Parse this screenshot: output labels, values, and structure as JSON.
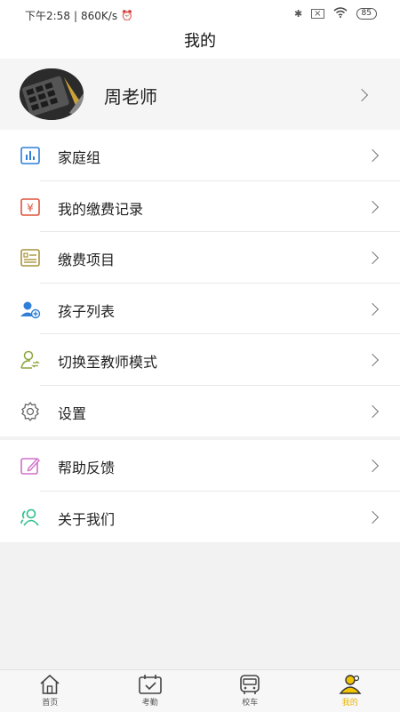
{
  "status_bar": {
    "time": "下午2:58",
    "speed": "860K/s",
    "battery": "85"
  },
  "header": {
    "title": "我的"
  },
  "profile": {
    "name": "周老师"
  },
  "menu_group_1": [
    {
      "label": "家庭组",
      "icon": "bar-chart-icon"
    },
    {
      "label": "我的缴费记录",
      "icon": "yen-icon"
    },
    {
      "label": "缴费项目",
      "icon": "bill-list-icon"
    },
    {
      "label": "孩子列表",
      "icon": "child-add-icon"
    },
    {
      "label": "切换至教师模式",
      "icon": "switch-user-icon"
    },
    {
      "label": "设置",
      "icon": "gear-icon"
    }
  ],
  "menu_group_2": [
    {
      "label": "帮助反馈",
      "icon": "edit-icon"
    },
    {
      "label": "关于我们",
      "icon": "users-icon"
    }
  ],
  "tabbar": {
    "items": [
      {
        "label": "首页",
        "icon": "home-icon"
      },
      {
        "label": "考勤",
        "icon": "calendar-check-icon"
      },
      {
        "label": "校车",
        "icon": "bus-icon"
      },
      {
        "label": "我的",
        "icon": "profile-icon",
        "active": true
      }
    ]
  },
  "colors": {
    "accent": "#e8b400",
    "blue": "#2f7fd6",
    "red": "#e0533b",
    "olive": "#a8943a",
    "purple": "#d070c8",
    "green": "#2dbf8a"
  }
}
